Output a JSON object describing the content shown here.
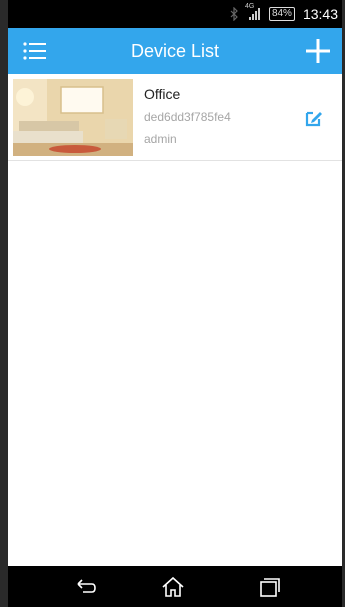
{
  "status_bar": {
    "network": "4G",
    "battery": "84%",
    "time": "13:43"
  },
  "app_bar": {
    "title": "Device List",
    "menu_icon": "list-menu-icon",
    "add_icon": "plus-icon",
    "background_color": "#33a6ec"
  },
  "devices": [
    {
      "name": "Office",
      "id": "ded6dd3f785fe4",
      "user": "admin",
      "edit_icon": "edit-icon"
    }
  ],
  "nav_bar": {
    "back_icon": "back-icon",
    "home_icon": "home-icon",
    "recent_icon": "recent-apps-icon"
  }
}
